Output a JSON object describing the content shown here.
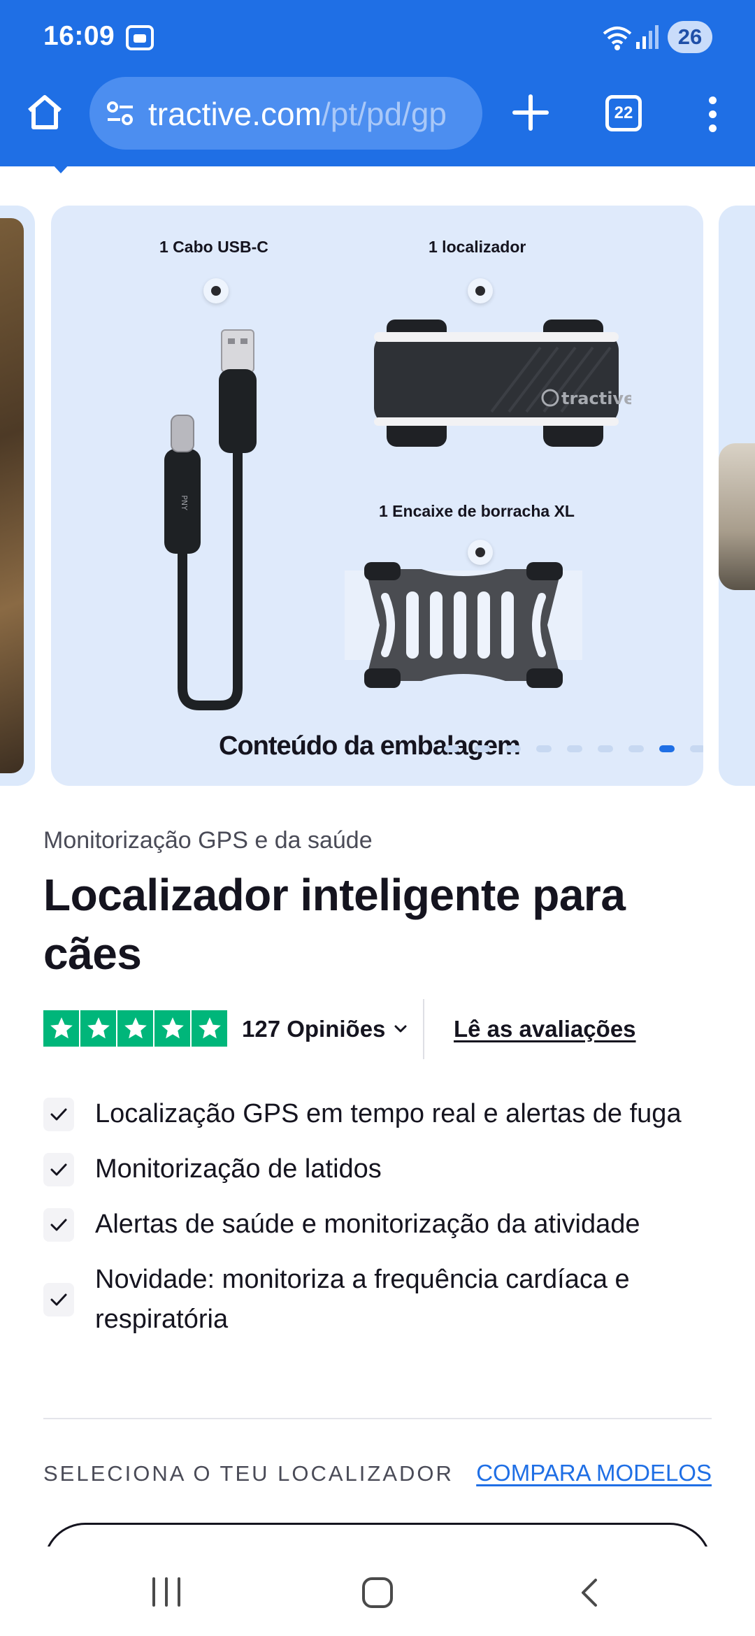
{
  "status_bar": {
    "time": "16:09",
    "battery": "26",
    "icons": [
      "gallery-icon",
      "wifi-icon",
      "signal-icon"
    ]
  },
  "browser": {
    "url_host": "tractive.com",
    "url_path": "/pt/pd/gp",
    "tab_count": "22",
    "icons": [
      "home-icon",
      "tune-icon",
      "plus-icon",
      "more-vert-icon"
    ],
    "accent_color": "#1f6fe5"
  },
  "carousel": {
    "card_title": "Conteúdo da embalagem",
    "items": [
      {
        "label": "1 Cabo USB-C"
      },
      {
        "label": "1 localizador"
      },
      {
        "label": "1 Encaixe de borracha XL"
      }
    ],
    "tracker_brand": "tractive",
    "cable_brand": "PNY",
    "page_count": 9,
    "active_page": 7
  },
  "product": {
    "eyebrow": "Monitorização GPS e da saúde",
    "title": "Localizador inteligente para cães",
    "rating": {
      "stars": 5,
      "reviews_label": "127 Opiniões",
      "read_reviews": "Lê as avaliações",
      "star_color": "#00b67a"
    },
    "features": [
      "Localização GPS em tempo real e alertas de fuga",
      "Monitorização de latidos",
      "Alertas de saúde e monitorização da atividade",
      "Novidade: monitoriza a frequência cardíaca e respiratória"
    ]
  },
  "selector": {
    "label": "SELECIONA O TEU LOCALIZADOR",
    "compare_link": "COMPARA MODELOS"
  },
  "nav_bar": {
    "icons": [
      "recent-apps-icon",
      "home-nav-icon",
      "back-icon"
    ]
  }
}
